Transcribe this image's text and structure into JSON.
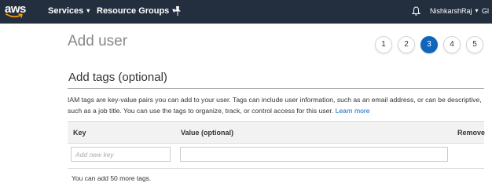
{
  "topbar": {
    "logo_text": "aws",
    "services_label": "Services",
    "resource_groups_label": "Resource Groups",
    "user_label": "NishkarshRaj",
    "region_label": "Gl",
    "icons": [
      "aws-logo",
      "pin-icon",
      "bell-icon",
      "chevron-down-icon"
    ]
  },
  "page": {
    "title": "Add user"
  },
  "steps": [
    "1",
    "2",
    "3",
    "4",
    "5"
  ],
  "active_step": "3",
  "section": {
    "title": "Add tags (optional)",
    "description": "IAM tags are key-value pairs you can add to your user. Tags can include user information, such as an email address, or can be descriptive, such as a job title. You can use the tags to organize, track, or control access for this user.",
    "learn_more": "Learn more"
  },
  "table": {
    "headers": {
      "key": "Key",
      "value": "Value (optional)",
      "remove": "Remove"
    },
    "rows": [
      {
        "key_value": "",
        "key_placeholder": "Add new key",
        "value_value": ""
      }
    ]
  },
  "footer_note": "You can add 50 more tags.",
  "colors": {
    "topbar_bg": "#232f3e",
    "active_step": "#1166bb",
    "link": "#0066cc",
    "aws_smile": "#ff9900"
  }
}
